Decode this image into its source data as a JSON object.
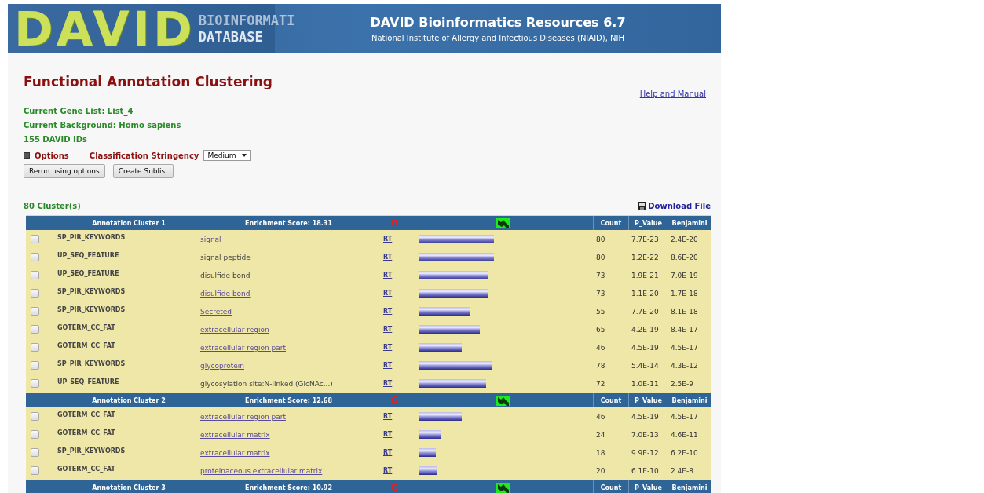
{
  "banner": {
    "logo": "DAVID",
    "logo_sub_1": "BIOINFORMATI",
    "logo_sub_2": "DATABASE",
    "title": "DAVID Bioinformatics Resources 6.7",
    "subtitle": "National Institute of Allergy and Infectious Diseases (NIAID), NIH"
  },
  "page_title": "Functional Annotation Clustering",
  "help_link": "Help and Manual",
  "info": [
    "Current Gene List: List_4",
    "Current Background: Homo sapiens",
    "155 DAVID IDs"
  ],
  "options": {
    "label": "Options",
    "stringency_label": "Classification Stringency",
    "stringency": "Medium"
  },
  "buttons": [
    "Rerun using options",
    "Create Sublist"
  ],
  "cluster_count": "80 Cluster(s)",
  "download": "Download File",
  "clusters": [
    {
      "name": "Annotation Cluster 1",
      "score": "Enrichment Score: 18.31",
      "g": "G",
      "columns": [
        "Count",
        "P_Value",
        "Benjamini"
      ],
      "rows": [
        {
          "checked": false,
          "category": "SP_PIR_KEYWORDS",
          "term": "signal",
          "link": true,
          "rt": "RT",
          "count": "80",
          "p_value": "7.7E-23",
          "benjamini": "2.4E-20"
        },
        {
          "checked": false,
          "category": "UP_SEQ_FEATURE",
          "term": "signal peptide",
          "link": false,
          "rt": "RT",
          "count": "80",
          "p_value": "1.2E-22",
          "benjamini": "8.6E-20"
        },
        {
          "checked": false,
          "category": "UP_SEQ_FEATURE",
          "term": "disulfide bond",
          "link": false,
          "rt": "RT",
          "count": "73",
          "p_value": "1.9E-21",
          "benjamini": "7.0E-19"
        },
        {
          "checked": false,
          "category": "SP_PIR_KEYWORDS",
          "term": "disulfide bond",
          "link": true,
          "rt": "RT",
          "count": "73",
          "p_value": "1.1E-20",
          "benjamini": "1.7E-18"
        },
        {
          "checked": false,
          "category": "SP_PIR_KEYWORDS",
          "term": "Secreted",
          "link": true,
          "rt": "RT",
          "count": "55",
          "p_value": "7.7E-20",
          "benjamini": "8.1E-18"
        },
        {
          "checked": false,
          "category": "GOTERM_CC_FAT",
          "term": "extracellular region",
          "link": true,
          "rt": "RT",
          "count": "65",
          "p_value": "4.2E-19",
          "benjamini": "8.4E-17"
        },
        {
          "checked": false,
          "category": "GOTERM_CC_FAT",
          "term": "extracellular region part",
          "link": true,
          "rt": "RT",
          "count": "46",
          "p_value": "4.5E-19",
          "benjamini": "4.5E-17"
        },
        {
          "checked": false,
          "category": "SP_PIR_KEYWORDS",
          "term": "glycoprotein",
          "link": true,
          "rt": "RT",
          "count": "78",
          "p_value": "5.4E-14",
          "benjamini": "4.3E-12"
        },
        {
          "checked": false,
          "category": "UP_SEQ_FEATURE",
          "term": "glycosylation site:N-linked (GlcNAc...)",
          "link": false,
          "rt": "RT",
          "count": "72",
          "p_value": "1.0E-11",
          "benjamini": "2.5E-9"
        }
      ]
    },
    {
      "name": "Annotation Cluster 2",
      "score": "Enrichment Score: 12.68",
      "g": "G",
      "columns": [
        "Count",
        "P_Value",
        "Benjamini"
      ],
      "rows": [
        {
          "checked": false,
          "category": "GOTERM_CC_FAT",
          "term": "extracellular region part",
          "link": true,
          "rt": "RT",
          "count": "46",
          "p_value": "4.5E-19",
          "benjamini": "4.5E-17"
        },
        {
          "checked": false,
          "category": "GOTERM_CC_FAT",
          "term": "extracellular matrix",
          "link": true,
          "rt": "RT",
          "count": "24",
          "p_value": "7.0E-13",
          "benjamini": "4.6E-11"
        },
        {
          "checked": false,
          "category": "SP_PIR_KEYWORDS",
          "term": "extracellular matrix",
          "link": true,
          "rt": "RT",
          "count": "18",
          "p_value": "9.9E-12",
          "benjamini": "6.2E-10"
        },
        {
          "checked": false,
          "category": "GOTERM_CC_FAT",
          "term": "proteinaceous extracellular matrix",
          "link": true,
          "rt": "RT",
          "count": "20",
          "p_value": "6.1E-10",
          "benjamini": "2.4E-8"
        }
      ]
    },
    {
      "name": "Annotation Cluster 3",
      "score": "Enrichment Score: 10.92",
      "g": "G",
      "columns": [
        "Count",
        "P_Value",
        "Benjamini"
      ]
    }
  ]
}
